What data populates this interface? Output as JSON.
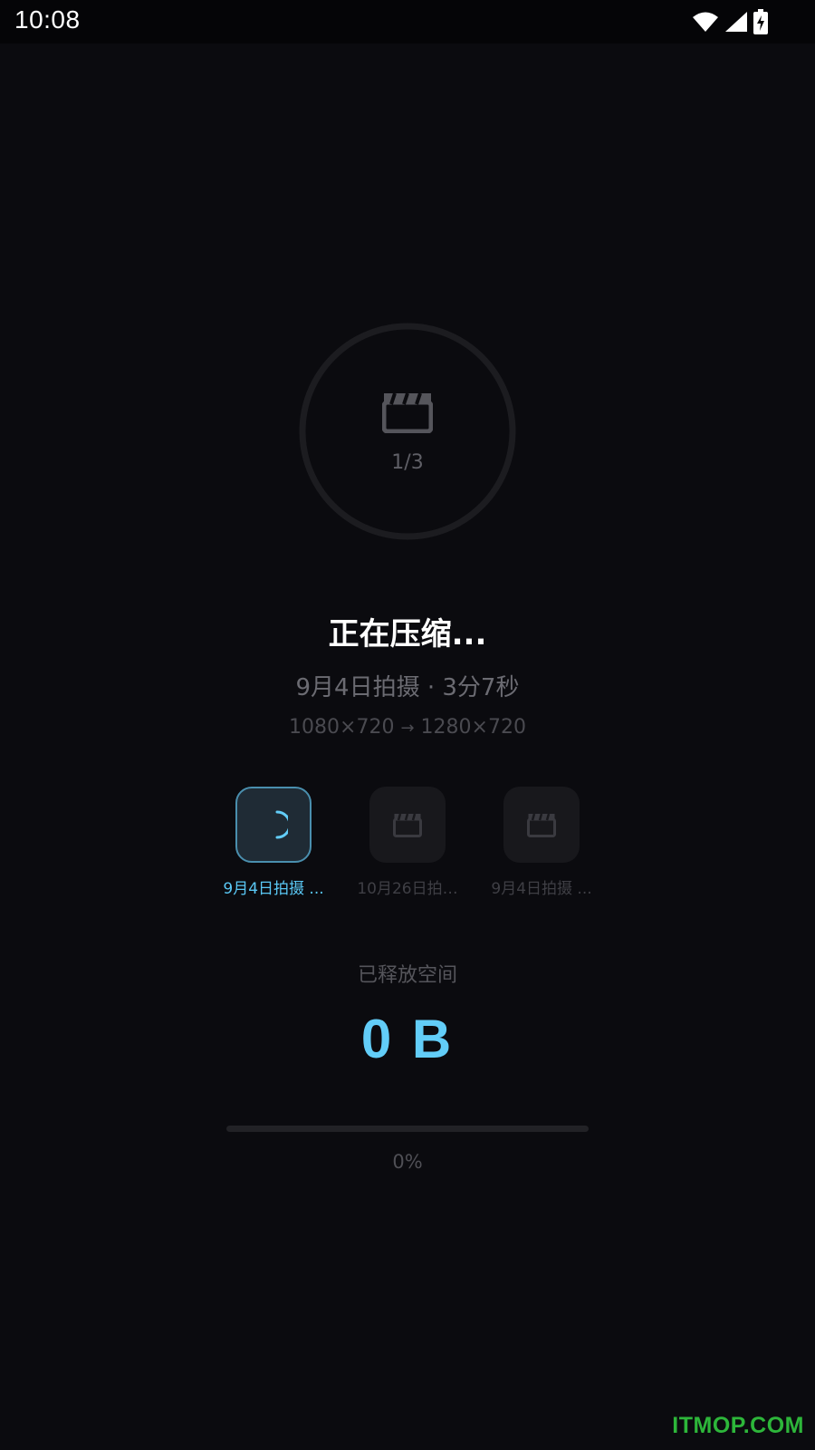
{
  "status_bar": {
    "time": "10:08",
    "icons": [
      "wifi-icon",
      "signal-icon",
      "battery-charging-icon"
    ]
  },
  "progress_ring": {
    "icon": "clapperboard-icon",
    "count": "1/3"
  },
  "compression": {
    "title": "正在压缩...",
    "subtitle": "9月4日拍摄 · 3分7秒",
    "resolution_from": "1080×720",
    "arrow": "→",
    "resolution_to": "1280×720"
  },
  "queue": [
    {
      "label": "9月4日拍摄 ...",
      "state": "active",
      "icon": "loading-spinner-icon"
    },
    {
      "label": "10月26日拍…",
      "state": "pending",
      "icon": "clapperboard-icon"
    },
    {
      "label": "9月4日拍摄 ...",
      "state": "pending",
      "icon": "clapperboard-icon"
    }
  ],
  "freed": {
    "label": "已释放空间",
    "value": "0 B"
  },
  "progress": {
    "fraction": 0,
    "label": "0%"
  },
  "watermark": "ITMOP.COM",
  "colors": {
    "background": "#0b0b0f",
    "accent": "#62cdf8",
    "watermark": "#2db63a"
  }
}
